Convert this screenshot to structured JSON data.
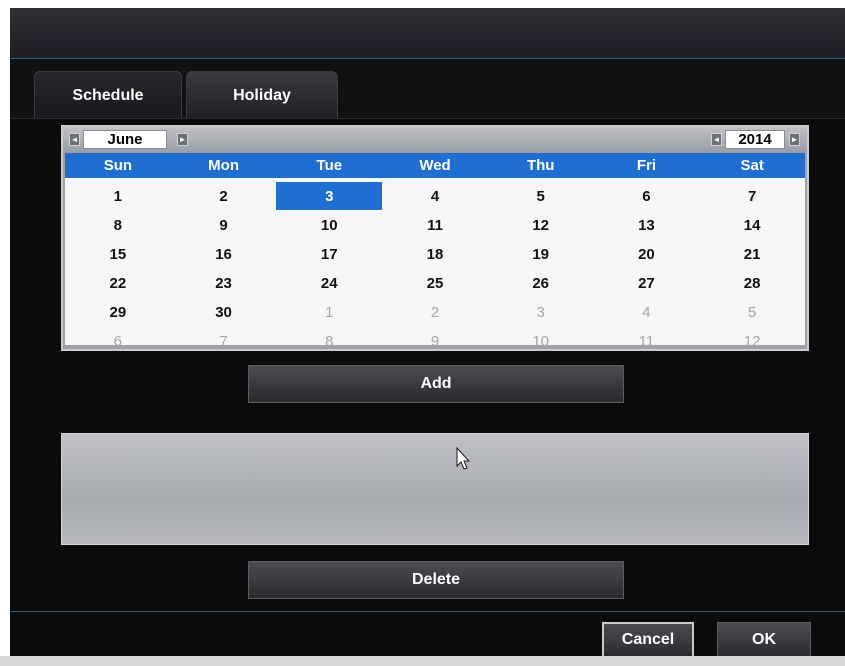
{
  "tabs": [
    {
      "label": "Schedule",
      "active": false
    },
    {
      "label": "Holiday",
      "active": true
    }
  ],
  "calendar": {
    "month": "June",
    "year": "2014",
    "weekdays": [
      "Sun",
      "Mon",
      "Tue",
      "Wed",
      "Thu",
      "Fri",
      "Sat"
    ],
    "selected_day": "3",
    "weeks": [
      [
        {
          "d": "1"
        },
        {
          "d": "2"
        },
        {
          "d": "3",
          "selected": true
        },
        {
          "d": "4"
        },
        {
          "d": "5"
        },
        {
          "d": "6"
        },
        {
          "d": "7"
        }
      ],
      [
        {
          "d": "8"
        },
        {
          "d": "9"
        },
        {
          "d": "10"
        },
        {
          "d": "11"
        },
        {
          "d": "12"
        },
        {
          "d": "13"
        },
        {
          "d": "14"
        }
      ],
      [
        {
          "d": "15"
        },
        {
          "d": "16"
        },
        {
          "d": "17"
        },
        {
          "d": "18"
        },
        {
          "d": "19"
        },
        {
          "d": "20"
        },
        {
          "d": "21"
        }
      ],
      [
        {
          "d": "22"
        },
        {
          "d": "23"
        },
        {
          "d": "24"
        },
        {
          "d": "25"
        },
        {
          "d": "26"
        },
        {
          "d": "27"
        },
        {
          "d": "28"
        }
      ],
      [
        {
          "d": "29"
        },
        {
          "d": "30"
        },
        {
          "d": "1",
          "muted": true
        },
        {
          "d": "2",
          "muted": true
        },
        {
          "d": "3",
          "muted": true
        },
        {
          "d": "4",
          "muted": true
        },
        {
          "d": "5",
          "muted": true
        }
      ],
      [
        {
          "d": "6",
          "muted": true
        },
        {
          "d": "7",
          "muted": true
        },
        {
          "d": "8",
          "muted": true
        },
        {
          "d": "9",
          "muted": true
        },
        {
          "d": "10",
          "muted": true
        },
        {
          "d": "11",
          "muted": true
        },
        {
          "d": "12",
          "muted": true
        }
      ]
    ]
  },
  "actions": {
    "add": "Add",
    "delete": "Delete"
  },
  "footer": {
    "cancel": "Cancel",
    "ok": "OK"
  },
  "colors": {
    "accent": "#1f6fd3",
    "muted_day": "#a9a69a"
  }
}
